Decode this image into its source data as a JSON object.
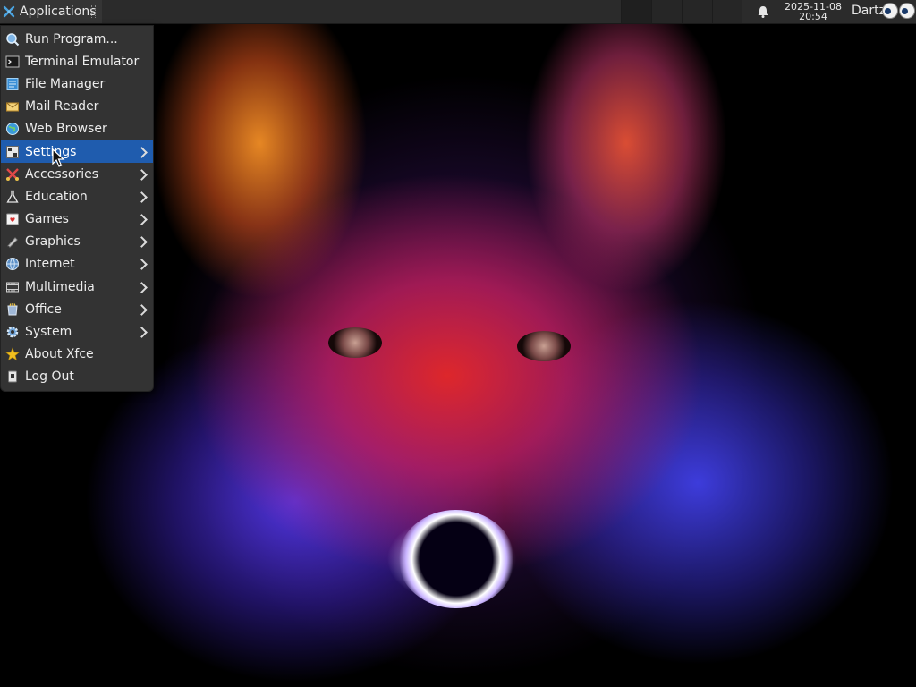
{
  "panel": {
    "applications_label": "Applications",
    "clock": {
      "date": "2025-11-08",
      "time": "20:54"
    },
    "username": "Dartz",
    "workspaces": [
      "",
      "",
      "",
      "",
      ""
    ]
  },
  "menu": {
    "selected": "Settings",
    "items": [
      {
        "label": "Run Program...",
        "icon": "run-program-icon",
        "submenu": false
      },
      {
        "label": "Terminal Emulator",
        "icon": "terminal-icon",
        "submenu": false
      },
      {
        "label": "File Manager",
        "icon": "file-manager-icon",
        "submenu": false
      },
      {
        "label": "Mail Reader",
        "icon": "mail-icon",
        "submenu": false
      },
      {
        "label": "Web Browser",
        "icon": "web-browser-icon",
        "submenu": false
      },
      {
        "label": "Settings",
        "icon": "settings-icon",
        "submenu": true
      },
      {
        "label": "Accessories",
        "icon": "accessories-icon",
        "submenu": true
      },
      {
        "label": "Education",
        "icon": "education-icon",
        "submenu": true
      },
      {
        "label": "Games",
        "icon": "games-icon",
        "submenu": true
      },
      {
        "label": "Graphics",
        "icon": "graphics-icon",
        "submenu": true
      },
      {
        "label": "Internet",
        "icon": "internet-icon",
        "submenu": true
      },
      {
        "label": "Multimedia",
        "icon": "multimedia-icon",
        "submenu": true
      },
      {
        "label": "Office",
        "icon": "office-icon",
        "submenu": true
      },
      {
        "label": "System",
        "icon": "system-icon",
        "submenu": true
      },
      {
        "label": "About Xfce",
        "icon": "star-icon",
        "submenu": false
      },
      {
        "label": "Log Out",
        "icon": "logout-icon",
        "submenu": false
      }
    ]
  },
  "colors": {
    "panel_bg": "#2b2b2b",
    "menu_bg": "#333333",
    "selection": "#1f5cae"
  }
}
